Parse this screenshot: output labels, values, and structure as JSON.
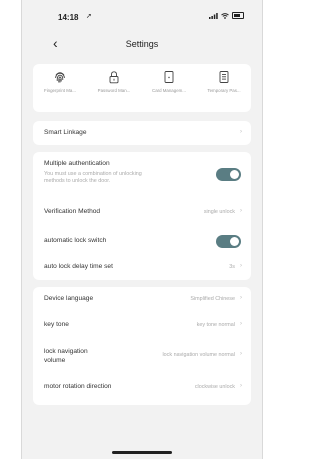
{
  "status": {
    "time": "14:18",
    "location_glyph": "➚",
    "icons": [
      "signal-icon",
      "wifi-icon",
      "battery-icon"
    ]
  },
  "nav": {
    "back": "‹",
    "title": "Settings"
  },
  "features": [
    {
      "label": "Fingerprint Ma...",
      "icon": "fingerprint-icon"
    },
    {
      "label": "Password Man...",
      "icon": "padlock-icon"
    },
    {
      "label": "Card Managem...",
      "icon": "card-icon"
    },
    {
      "label": "Temporary Pas...",
      "icon": "temporary-password-icon"
    }
  ],
  "smart_linkage": {
    "label": "Smart Linkage",
    "chevron": "›"
  },
  "security": {
    "multiple_auth": {
      "label": "Multiple authentication",
      "desc_line1": "You must use a combination of unlocking",
      "desc_line2": "methods to unlock the door.",
      "enabled": true
    },
    "verification": {
      "label": "Verification Method",
      "value": "single unlock",
      "chevron": "›"
    },
    "auto_lock": {
      "label": "automatic lock switch",
      "enabled": true
    },
    "delay": {
      "label": "auto lock delay time set",
      "value": "3s",
      "chevron": "›"
    }
  },
  "device": {
    "language": {
      "label": "Device language",
      "value": "Simplified Chinese",
      "chevron": "›"
    },
    "key_tone": {
      "label": "key tone",
      "value": "key tone normal",
      "chevron": "›"
    },
    "nav_volume": {
      "label_line1": "lock navigation",
      "label_line2": "volume",
      "value": "lock navigation volume normal",
      "chevron": "›"
    },
    "motor": {
      "label": "motor rotation direction",
      "value": "clockwise unlock",
      "chevron": "›"
    }
  },
  "colors": {
    "toggle_on": "#5a7d83",
    "background": "#f2f2f2",
    "card": "#ffffff"
  }
}
